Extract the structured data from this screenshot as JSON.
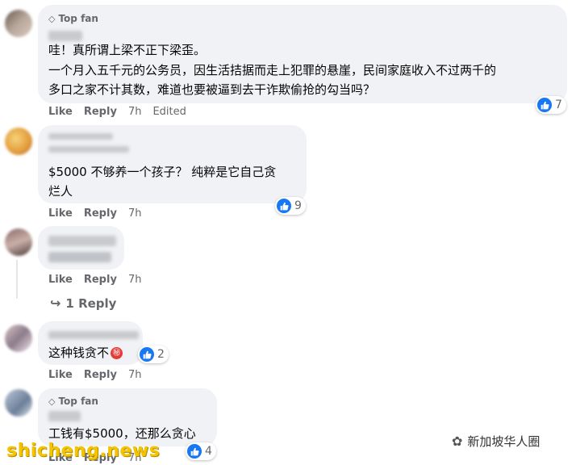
{
  "actions": {
    "like": "Like",
    "reply": "Reply",
    "edited": "Edited"
  },
  "badges": {
    "top_fan": "Top fan"
  },
  "comments": [
    {
      "lines": [
        "哇！真所谓上梁不正下梁歪。",
        "一个月入五千元的公务员，因生活拮据而走上犯罪的悬崖，民间家庭收入不过两千的",
        "多口之家不计其数，难道也要被逼到去干诈欺偷抢的勾当吗？"
      ],
      "time": "7h",
      "likes": "7"
    },
    {
      "lines": [
        "$5000 不够养一个孩子？ 纯粹是它自己贪",
        "烂人"
      ],
      "time": "7h",
      "likes": "9"
    },
    {
      "time": "7h",
      "replies": "1 Reply"
    },
    {
      "lines": [
        "这种钱贪不"
      ],
      "time": "7h",
      "likes": "2"
    },
    {
      "lines": [
        "工钱有$5000，还那么贪心"
      ],
      "time": "7h",
      "likes": "4"
    }
  ],
  "watermark": {
    "site": "shicheng.news",
    "account": "新加坡华人圈"
  },
  "colors": {
    "bubble": "#f0f2f5",
    "like_blue": "#1877f2",
    "meta_gray": "#65676b"
  }
}
